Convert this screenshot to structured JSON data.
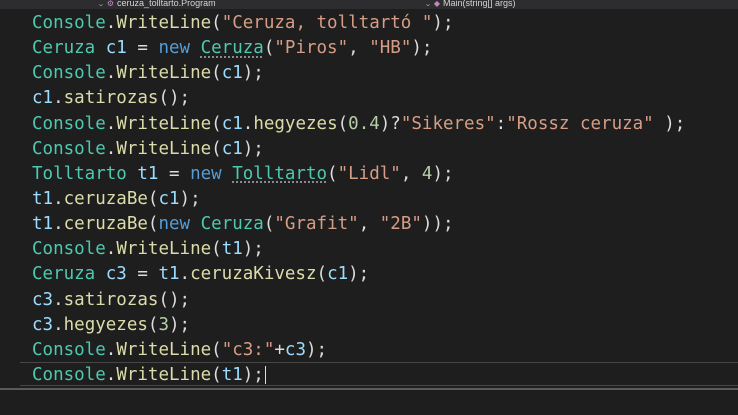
{
  "navigation": {
    "class_path": "ceruza_tolltarto.Program",
    "class_icon": "class-icon",
    "member": "Main(string[] args)",
    "member_icon": "method-icon"
  },
  "code_lines": [
    [
      {
        "t": "Console",
        "k": "type"
      },
      {
        "t": ".",
        "k": "plain"
      },
      {
        "t": "WriteLine",
        "k": "method"
      },
      {
        "t": "(",
        "k": "plain"
      },
      {
        "t": "\"Ceruza, tolltartó \"",
        "k": "string"
      },
      {
        "t": ");",
        "k": "plain"
      }
    ],
    [
      {
        "t": "Ceruza",
        "k": "type"
      },
      {
        "t": " ",
        "k": "plain"
      },
      {
        "t": "c1",
        "k": "var"
      },
      {
        "t": " = ",
        "k": "plain"
      },
      {
        "t": "new",
        "k": "keyword"
      },
      {
        "t": " ",
        "k": "plain"
      },
      {
        "t": "Ceruza",
        "k": "type",
        "s": 1
      },
      {
        "t": "(",
        "k": "plain"
      },
      {
        "t": "\"Piros\"",
        "k": "string"
      },
      {
        "t": ", ",
        "k": "plain"
      },
      {
        "t": "\"HB\"",
        "k": "string"
      },
      {
        "t": ");",
        "k": "plain"
      }
    ],
    [
      {
        "t": "Console",
        "k": "type"
      },
      {
        "t": ".",
        "k": "plain"
      },
      {
        "t": "WriteLine",
        "k": "method"
      },
      {
        "t": "(",
        "k": "plain"
      },
      {
        "t": "c1",
        "k": "var"
      },
      {
        "t": ");",
        "k": "plain"
      }
    ],
    [
      {
        "t": "c1",
        "k": "var"
      },
      {
        "t": ".",
        "k": "plain"
      },
      {
        "t": "satirozas",
        "k": "method"
      },
      {
        "t": "();",
        "k": "plain"
      }
    ],
    [
      {
        "t": "Console",
        "k": "type"
      },
      {
        "t": ".",
        "k": "plain"
      },
      {
        "t": "WriteLine",
        "k": "method"
      },
      {
        "t": "(",
        "k": "plain"
      },
      {
        "t": "c1",
        "k": "var"
      },
      {
        "t": ".",
        "k": "plain"
      },
      {
        "t": "hegyezes",
        "k": "method"
      },
      {
        "t": "(",
        "k": "plain"
      },
      {
        "t": "0.4",
        "k": "number"
      },
      {
        "t": ")?",
        "k": "plain"
      },
      {
        "t": "\"Sikeres\"",
        "k": "string"
      },
      {
        "t": ":",
        "k": "plain"
      },
      {
        "t": "\"Rossz ceruza\"",
        "k": "string"
      },
      {
        "t": " );",
        "k": "plain"
      }
    ],
    [
      {
        "t": "Console",
        "k": "type"
      },
      {
        "t": ".",
        "k": "plain"
      },
      {
        "t": "WriteLine",
        "k": "method"
      },
      {
        "t": "(",
        "k": "plain"
      },
      {
        "t": "c1",
        "k": "var"
      },
      {
        "t": ");",
        "k": "plain"
      }
    ],
    [
      {
        "t": "Tolltarto",
        "k": "type"
      },
      {
        "t": " ",
        "k": "plain"
      },
      {
        "t": "t1",
        "k": "var"
      },
      {
        "t": " = ",
        "k": "plain"
      },
      {
        "t": "new",
        "k": "keyword"
      },
      {
        "t": " ",
        "k": "plain"
      },
      {
        "t": "Tolltarto",
        "k": "type",
        "s": 1
      },
      {
        "t": "(",
        "k": "plain"
      },
      {
        "t": "\"Lidl\"",
        "k": "string"
      },
      {
        "t": ", ",
        "k": "plain"
      },
      {
        "t": "4",
        "k": "number"
      },
      {
        "t": ");",
        "k": "plain"
      }
    ],
    [
      {
        "t": "t1",
        "k": "var"
      },
      {
        "t": ".",
        "k": "plain"
      },
      {
        "t": "ceruzaBe",
        "k": "method"
      },
      {
        "t": "(",
        "k": "plain"
      },
      {
        "t": "c1",
        "k": "var"
      },
      {
        "t": ");",
        "k": "plain"
      }
    ],
    [
      {
        "t": "t1",
        "k": "var"
      },
      {
        "t": ".",
        "k": "plain"
      },
      {
        "t": "ceruzaBe",
        "k": "method"
      },
      {
        "t": "(",
        "k": "plain"
      },
      {
        "t": "new",
        "k": "keyword"
      },
      {
        "t": " ",
        "k": "plain"
      },
      {
        "t": "Ceruza",
        "k": "type"
      },
      {
        "t": "(",
        "k": "plain"
      },
      {
        "t": "\"Grafit\"",
        "k": "string"
      },
      {
        "t": ", ",
        "k": "plain"
      },
      {
        "t": "\"2B\"",
        "k": "string"
      },
      {
        "t": "));",
        "k": "plain"
      }
    ],
    [
      {
        "t": "Console",
        "k": "type"
      },
      {
        "t": ".",
        "k": "plain"
      },
      {
        "t": "WriteLine",
        "k": "method"
      },
      {
        "t": "(",
        "k": "plain"
      },
      {
        "t": "t1",
        "k": "var"
      },
      {
        "t": ");",
        "k": "plain"
      }
    ],
    [
      {
        "t": "Ceruza",
        "k": "type"
      },
      {
        "t": " ",
        "k": "plain"
      },
      {
        "t": "c3",
        "k": "var"
      },
      {
        "t": " = ",
        "k": "plain"
      },
      {
        "t": "t1",
        "k": "var"
      },
      {
        "t": ".",
        "k": "plain"
      },
      {
        "t": "ceruzaKivesz",
        "k": "method"
      },
      {
        "t": "(",
        "k": "plain"
      },
      {
        "t": "c1",
        "k": "var"
      },
      {
        "t": ");",
        "k": "plain"
      }
    ],
    [
      {
        "t": "c3",
        "k": "var"
      },
      {
        "t": ".",
        "k": "plain"
      },
      {
        "t": "satirozas",
        "k": "method"
      },
      {
        "t": "();",
        "k": "plain"
      }
    ],
    [
      {
        "t": "c3",
        "k": "var"
      },
      {
        "t": ".",
        "k": "plain"
      },
      {
        "t": "hegyezes",
        "k": "method"
      },
      {
        "t": "(",
        "k": "plain"
      },
      {
        "t": "3",
        "k": "number"
      },
      {
        "t": ");",
        "k": "plain"
      }
    ],
    [
      {
        "t": "Console",
        "k": "type"
      },
      {
        "t": ".",
        "k": "plain"
      },
      {
        "t": "WriteLine",
        "k": "method"
      },
      {
        "t": "(",
        "k": "plain"
      },
      {
        "t": "\"c3:\"",
        "k": "string"
      },
      {
        "t": "+",
        "k": "plain"
      },
      {
        "t": "c3",
        "k": "var"
      },
      {
        "t": ");",
        "k": "plain"
      }
    ],
    [
      {
        "t": "Console",
        "k": "type"
      },
      {
        "t": ".",
        "k": "plain"
      },
      {
        "t": "WriteLine",
        "k": "method"
      },
      {
        "t": "(",
        "k": "plain"
      },
      {
        "t": "t1",
        "k": "var"
      },
      {
        "t": ");",
        "k": "plain"
      }
    ]
  ],
  "colors": {
    "background": "#1e1e1e",
    "type": "#4ec9b0",
    "method": "#dcdcaa",
    "string": "#d69d85",
    "keyword": "#569cd6",
    "variable": "#9cdcfe",
    "number": "#b5cea8",
    "plain": "#dcdcdc"
  }
}
